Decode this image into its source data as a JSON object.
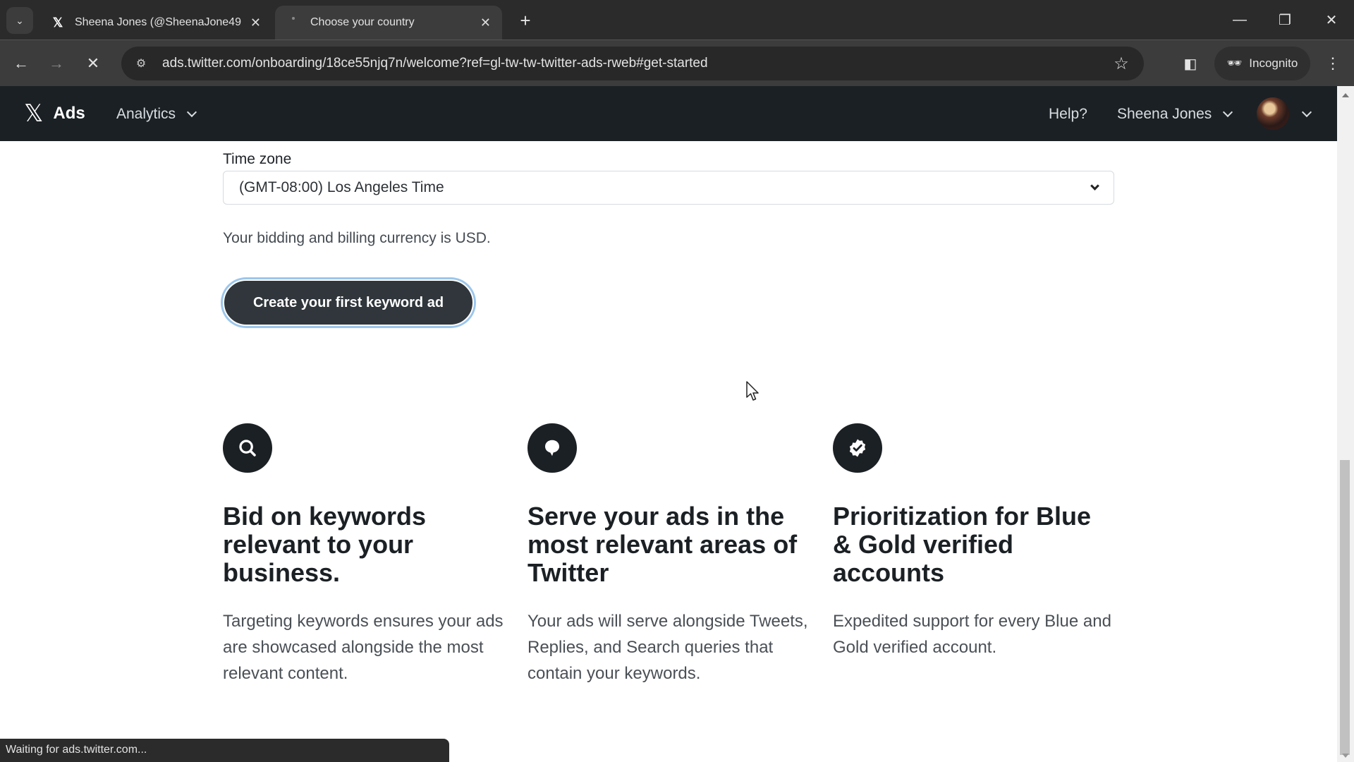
{
  "browser": {
    "tabs": [
      {
        "title": "Sheena Jones (@SheenaJone49",
        "favicon": "x-logo-icon",
        "active": false
      },
      {
        "title": "Choose your country",
        "favicon": "loading-icon",
        "active": true
      }
    ],
    "new_tab_label": "+",
    "url": "ads.twitter.com/onboarding/18ce55njq7n/welcome?ref=gl-tw-tw-twitter-ads-rweb#get-started",
    "incognito_label": "Incognito",
    "status_text": "Waiting for ads.twitter.com..."
  },
  "header": {
    "brand": "Ads",
    "nav_analytics": "Analytics",
    "help": "Help?",
    "user_name": "Sheena Jones"
  },
  "form": {
    "timezone_label": "Time zone",
    "timezone_value": "(GMT-08:00) Los Angeles Time",
    "currency_note": "Your bidding and billing currency is USD.",
    "cta_label": "Create your first keyword ad"
  },
  "features": [
    {
      "icon": "search-icon",
      "title": "Bid on keywords relevant to your business.",
      "body": "Targeting keywords ensures your ads are showcased alongside the most relevant content."
    },
    {
      "icon": "speech-bubble-icon",
      "title": "Serve your ads in the most relevant areas of Twitter",
      "body": "Your ads will serve alongside Tweets, Replies, and Search queries that contain your keywords."
    },
    {
      "icon": "verified-badge-icon",
      "title": "Prioritization for Blue & Gold verified accounts",
      "body": "Expedited support for every Blue and Gold verified account."
    }
  ]
}
